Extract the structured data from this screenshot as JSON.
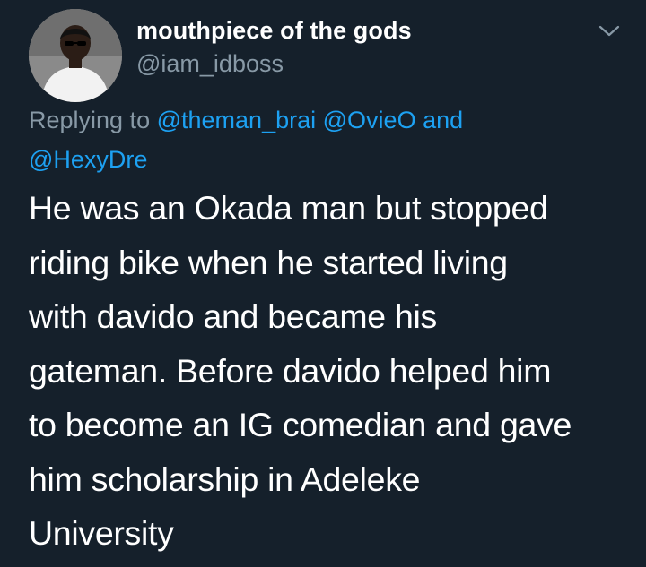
{
  "tweet": {
    "author": {
      "display_name": "mouthpiece of the gods",
      "handle": "@iam_idboss",
      "avatar_icon": "user-avatar"
    },
    "menu_icon": "chevron-down-icon",
    "reply": {
      "prefix": "Replying to",
      "mention_1": "@theman_brai",
      "mention_2": "@OvieO",
      "conjunction": "and",
      "mention_3": "@HexyDre"
    },
    "text_lines": [
      "He was an Okada man but stopped",
      "riding bike when he started living",
      "with davido and became his",
      "gateman. Before davido helped him",
      "to become an IG comedian and gave",
      "him scholarship in Adeleke",
      "University"
    ]
  },
  "colors": {
    "background": "#15202b",
    "primary_text": "#ffffff",
    "secondary_text": "#8899a6",
    "link": "#1da1f2"
  }
}
